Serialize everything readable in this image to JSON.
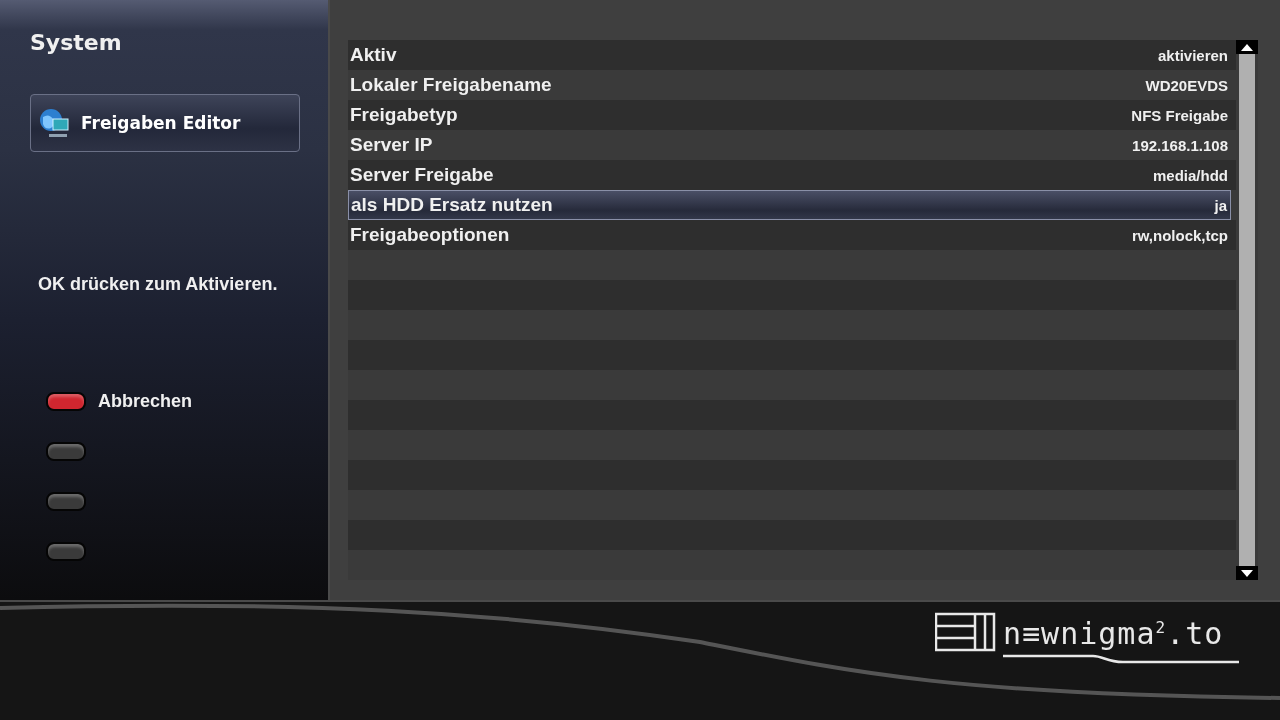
{
  "sidebar": {
    "title": "System",
    "menu_item": {
      "label": "Freigaben Editor",
      "selected": true
    },
    "hint": "OK drücken zum Aktivieren.",
    "color_keys": [
      {
        "color": "#d0262f",
        "label": "Abbrechen"
      },
      {
        "color": "#3a3a3a"
      },
      {
        "color": "#3a3a3a"
      },
      {
        "color": "#3a3a3a"
      }
    ]
  },
  "settings": [
    {
      "label": "Aktiv",
      "value": "aktivieren",
      "selected": false
    },
    {
      "label": "Lokaler Freigabename",
      "value": "WD20EVDS",
      "selected": false
    },
    {
      "label": "Freigabetyp",
      "value": "NFS Freigabe",
      "selected": false
    },
    {
      "label": "Server IP",
      "value": "192.168.1.108",
      "selected": false
    },
    {
      "label": "Server Freigabe",
      "value": "media/hdd",
      "selected": false
    },
    {
      "label": "als HDD Ersatz nutzen",
      "value": "ja",
      "selected": true
    },
    {
      "label": "Freigabeoptionen",
      "value": "rw,nolock,tcp",
      "selected": false
    }
  ],
  "footer": {
    "logo": "n≡wnigma$^{2}$.to"
  }
}
